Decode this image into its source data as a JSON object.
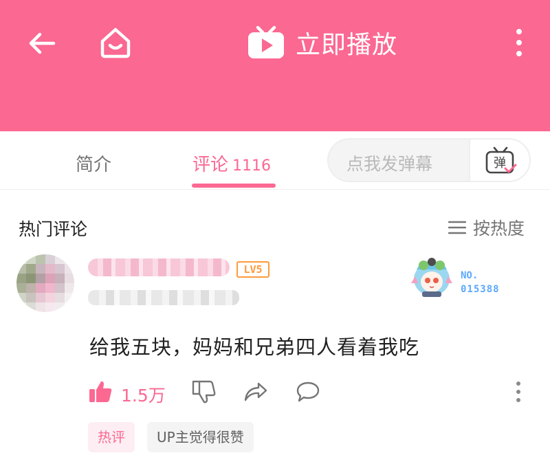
{
  "header": {
    "play_label": "立即播放",
    "icons": [
      "back-arrow-icon",
      "home-icon",
      "tv-play-icon",
      "more-vertical-icon"
    ],
    "bg_color": "#fb6892"
  },
  "tabs": {
    "intro_label": "简介",
    "comments_label": "评论",
    "comments_count": "1116",
    "active": "comments",
    "accent_color": "#fb6892"
  },
  "danmu": {
    "placeholder": "点我发弹幕",
    "button_icon": "danmu-tv-icon",
    "button_text": "弹"
  },
  "comments_section": {
    "title": "热门评论",
    "sort_label": "按热度",
    "sort_icon": "list-icon"
  },
  "comment": {
    "level": "LV5",
    "fan_badge": {
      "label": "NO.",
      "number": "015388"
    },
    "text": "给我五块，妈妈和兄弟四人看着我吃",
    "like_count": "1.5万",
    "tags": {
      "hot": "热评",
      "up_liked": "UP主觉得很赞"
    },
    "level_color": "#ff9a3c"
  }
}
